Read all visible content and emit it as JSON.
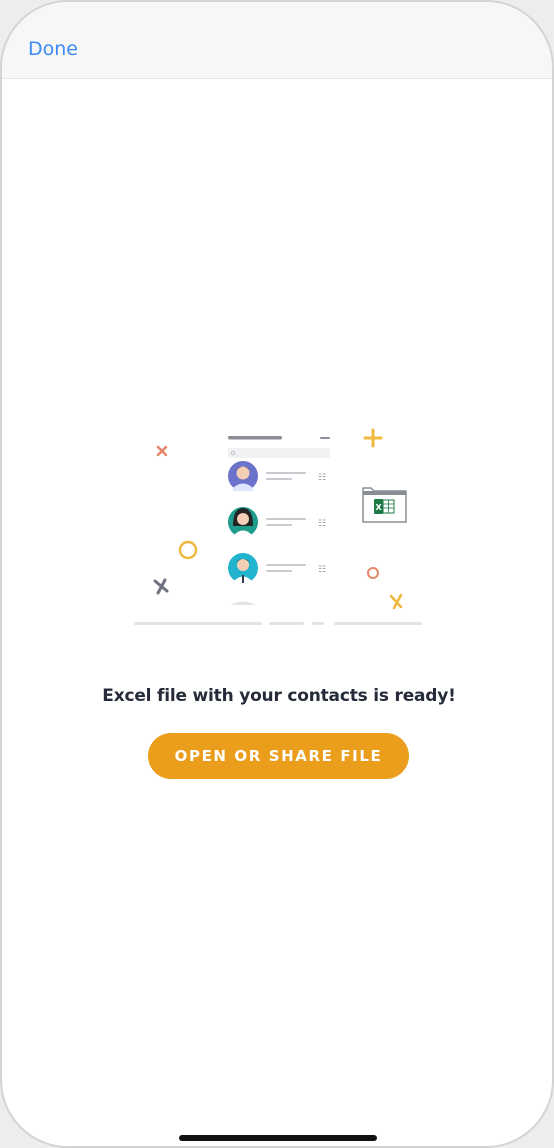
{
  "nav": {
    "done_label": "Done"
  },
  "illustration": {
    "file_icon_letter": "X",
    "file_type": "excel-file-icon",
    "contacts_count_shown": 3
  },
  "main": {
    "message": "Excel file with your contacts is ready!",
    "button_label": "OPEN OR SHARE FILE"
  },
  "colors": {
    "accent_button": "#eb9d1c",
    "link_blue": "#3d8bf2",
    "text_dark": "#262b3a",
    "excel_green": "#1d7a45",
    "decor_orange": "#e8866a",
    "decor_yellow": "#f0b83c",
    "decor_gray": "#6f7380"
  }
}
